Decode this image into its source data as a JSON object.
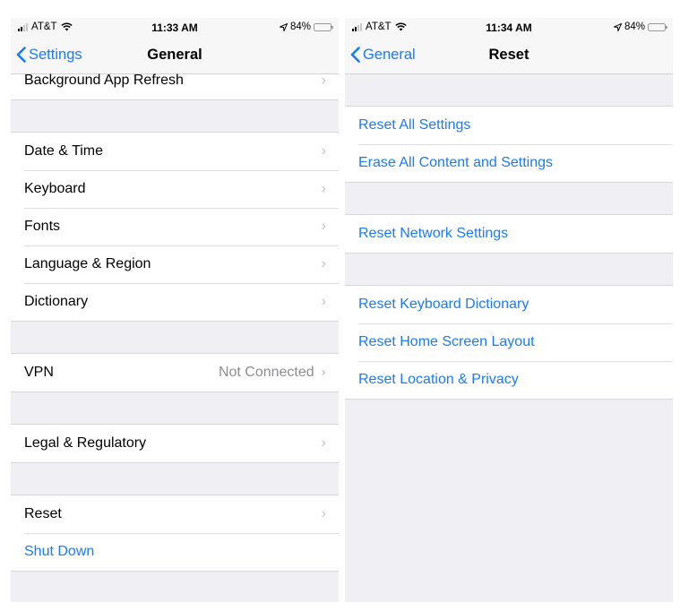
{
  "screens": [
    {
      "status": {
        "carrier": "AT&T",
        "time": "11:33 AM",
        "battery": "84%",
        "battery_level": 0.84
      },
      "nav": {
        "back_label": "Settings",
        "title": "General"
      },
      "partial_row": {
        "label": "Background App Refresh"
      },
      "groups": [
        {
          "rows": [
            {
              "label": "Date & Time"
            },
            {
              "label": "Keyboard"
            },
            {
              "label": "Fonts"
            },
            {
              "label": "Language & Region"
            },
            {
              "label": "Dictionary"
            }
          ]
        },
        {
          "rows": [
            {
              "label": "VPN",
              "detail": "Not Connected"
            }
          ]
        },
        {
          "rows": [
            {
              "label": "Legal & Regulatory"
            }
          ]
        },
        {
          "rows": [
            {
              "label": "Reset"
            },
            {
              "label": "Shut Down"
            }
          ]
        }
      ]
    },
    {
      "status": {
        "carrier": "AT&T",
        "time": "11:34 AM",
        "battery": "84%",
        "battery_level": 0.84
      },
      "nav": {
        "back_label": "General",
        "title": "Reset"
      },
      "groups": [
        {
          "rows": [
            {
              "label": "Reset All Settings"
            },
            {
              "label": "Erase All Content and Settings"
            }
          ]
        },
        {
          "rows": [
            {
              "label": "Reset Network Settings"
            }
          ]
        },
        {
          "rows": [
            {
              "label": "Reset Keyboard Dictionary"
            },
            {
              "label": "Reset Home Screen Layout"
            },
            {
              "label": "Reset Location & Privacy"
            }
          ]
        }
      ]
    }
  ],
  "icons": {
    "chevron": "›",
    "back": "chevron-left",
    "location": "location-arrow",
    "wifi": "wifi",
    "signal": "cell-signal",
    "battery": "battery"
  },
  "colors": {
    "accent": "#1a7cf5",
    "background": "#efeff4",
    "cell": "#ffffff",
    "detail": "#8e8e93"
  }
}
